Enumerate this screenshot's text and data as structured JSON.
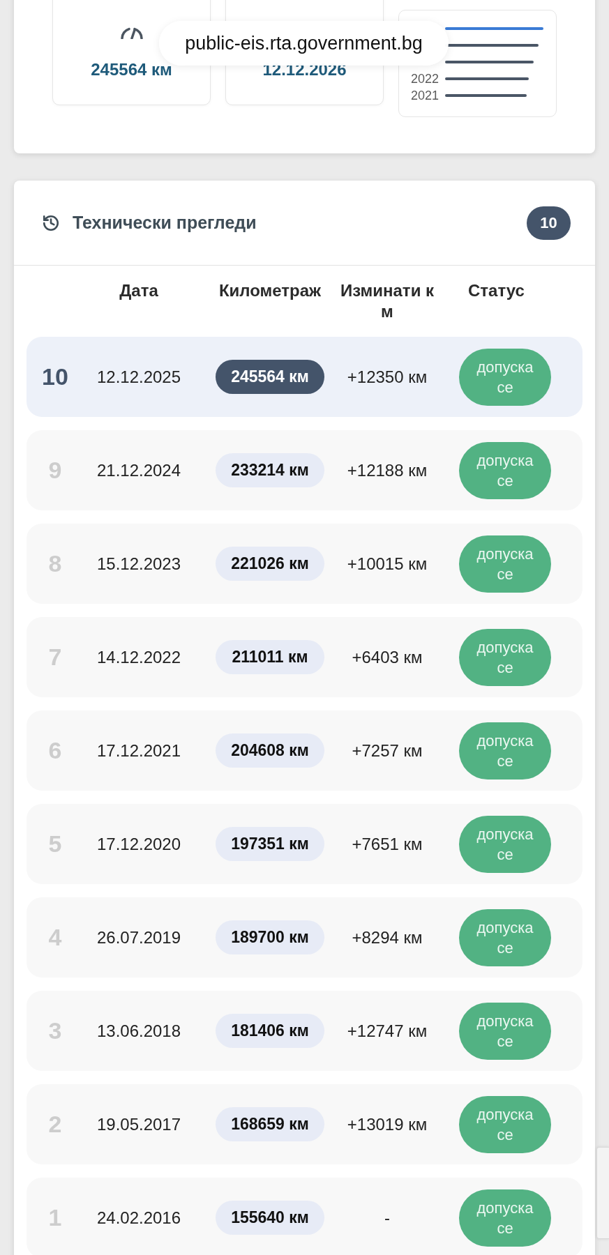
{
  "browser_bar": {
    "url": "public-eis.rta.government.bg"
  },
  "summary": {
    "cards": [
      {
        "kind": "mileage",
        "value": "245564 км"
      },
      {
        "kind": "date",
        "value": "12.12.2026"
      }
    ],
    "mileage_chart": {
      "year_labels": [
        "2022",
        "2021"
      ]
    }
  },
  "inspections": {
    "title": "Технически прегледи",
    "count": "10",
    "columns": [
      "Дата",
      "Километраж",
      "Изминати км",
      "Статус"
    ],
    "rows": [
      {
        "number": "10",
        "date": "12.12.2025",
        "mileage": "245564 км",
        "distance": "+12350 км",
        "status": "допуска се",
        "selected": true
      },
      {
        "number": "9",
        "date": "21.12.2024",
        "mileage": "233214 км",
        "distance": "+12188 км",
        "status": "допуска се",
        "selected": false
      },
      {
        "number": "8",
        "date": "15.12.2023",
        "mileage": "221026 км",
        "distance": "+10015 км",
        "status": "допуска се",
        "selected": false
      },
      {
        "number": "7",
        "date": "14.12.2022",
        "mileage": "211011 км",
        "distance": "+6403 км",
        "status": "допуска се",
        "selected": false
      },
      {
        "number": "6",
        "date": "17.12.2021",
        "mileage": "204608 км",
        "distance": "+7257 км",
        "status": "допуска се",
        "selected": false
      },
      {
        "number": "5",
        "date": "17.12.2020",
        "mileage": "197351 км",
        "distance": "+7651 км",
        "status": "допуска се",
        "selected": false
      },
      {
        "number": "4",
        "date": "26.07.2019",
        "mileage": "189700 км",
        "distance": "+8294 км",
        "status": "допуска се",
        "selected": false
      },
      {
        "number": "3",
        "date": "13.06.2018",
        "mileage": "181406 км",
        "distance": "+12747 км",
        "status": "допуска се",
        "selected": false
      },
      {
        "number": "2",
        "date": "19.05.2017",
        "mileage": "168659 км",
        "distance": "+13019 км",
        "status": "допуска се",
        "selected": false
      },
      {
        "number": "1",
        "date": "24.02.2016",
        "mileage": "155640 км",
        "distance": "-",
        "status": "допуска се",
        "selected": false
      }
    ]
  }
}
